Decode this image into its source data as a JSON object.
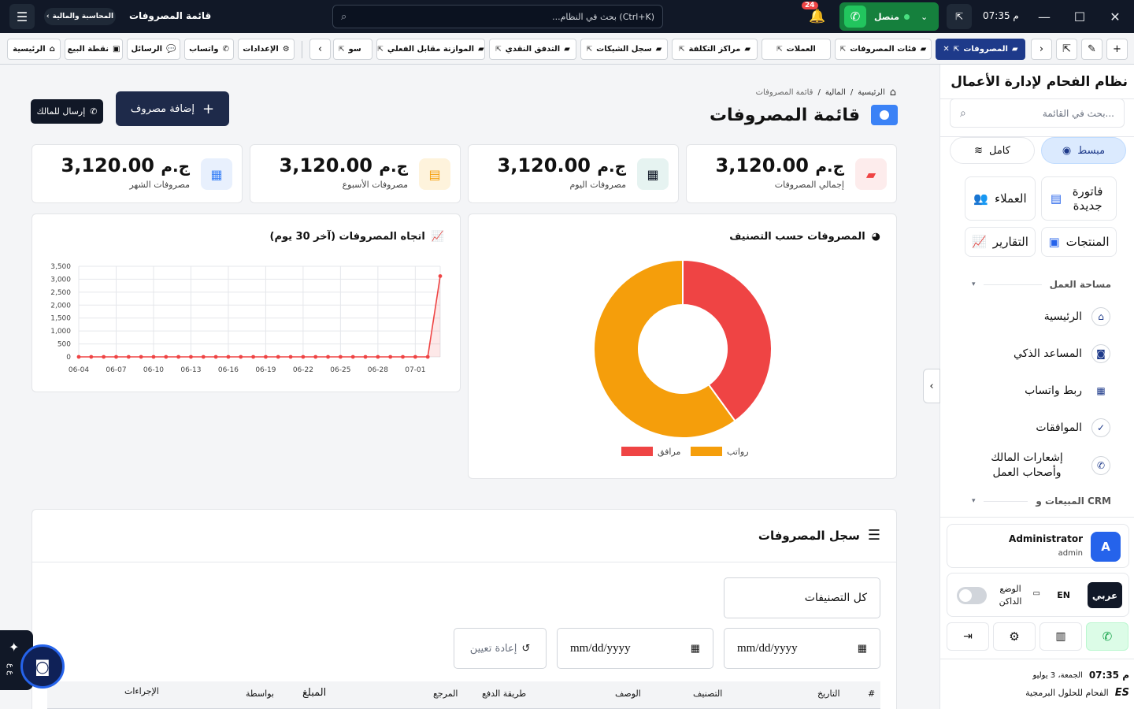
{
  "topbar": {
    "time": "07:35 م",
    "status": "متصل",
    "notifications_count": "24",
    "search_placeholder": "...بحث في النظام",
    "search_shortcut": "(Ctrl+K)",
    "page_title": "قائمة المصروفات",
    "section_pill": "المحاسبة والمالية"
  },
  "tabs": [
    {
      "label": "المصروفات",
      "active": true
    },
    {
      "label": "فئات المصروفات"
    },
    {
      "label": "العملات"
    },
    {
      "label": "مراكز التكلفة"
    },
    {
      "label": "سجل الشيكات"
    },
    {
      "label": "التدفق النقدي"
    },
    {
      "label": "الموازنة مقابل الفعلي"
    },
    {
      "label": "سو"
    }
  ],
  "shortcuts": {
    "settings": "الإعدادات",
    "whatsapp": "واتساب",
    "messages": "الرسائل",
    "pos": "نقطة البيع",
    "home": "الرئيسية"
  },
  "sidebar": {
    "brand": "نظام الفحام لإدارة الأعمال",
    "search_placeholder": "بحث في القائمة...",
    "mode_simple": "مبسط",
    "mode_full": "كامل",
    "quick": {
      "new_invoice": "فاتورة جديدة",
      "customers": "العملاء",
      "products": "المنتجات",
      "reports": "التقارير"
    },
    "section_workspace": "مساحة العمل",
    "links": {
      "home": "الرئيسية",
      "assistant": "المساعد الذكي",
      "whatsapp_link": "ربط واتساب",
      "approvals": "الموافقات",
      "owner_notify": "إشعارات المالك وأصحاب العمل"
    },
    "section_sales": "المبيعات و CRM",
    "user": {
      "name": "Administrator",
      "role": "admin",
      "initial": "A"
    },
    "lang_ar": "عربي",
    "lang_en": "EN",
    "dark_mode": "الوضع الداكن",
    "footer_time": "07:35 م",
    "footer_date": "الجمعة، 3 يوليو",
    "company": "الفحام للحلول البرمجية"
  },
  "page": {
    "breadcrumb": {
      "home": "الرئيسية",
      "finance": "المالية",
      "current": "قائمة المصروفات"
    },
    "title": "قائمة المصروفات",
    "add_button": "إضافة مصروف",
    "send_owner": "إرسال للمالك"
  },
  "stats": [
    {
      "value": "3,120.00",
      "currency": "ج.م",
      "label": "إجمالي المصروفات",
      "color": "#ef4444",
      "bg": "#fdecec"
    },
    {
      "value": "3,120.00",
      "currency": "ج.م",
      "label": "مصروفات اليوم",
      "color": "#111827",
      "bg": "#e6f3f1"
    },
    {
      "value": "3,120.00",
      "currency": "ج.م",
      "label": "مصروفات الأسبوع",
      "color": "#f59e0b",
      "bg": "#fef3dc"
    },
    {
      "value": "3,120.00",
      "currency": "ج.م",
      "label": "مصروفات الشهر",
      "color": "#3b82f6",
      "bg": "#e8f0fd"
    }
  ],
  "pie_card": {
    "title": "المصروفات حسب التصنيف"
  },
  "line_card": {
    "title": "اتجاه المصروفات (آخر 30 يوم)"
  },
  "chart_data": [
    {
      "type": "pie",
      "categories": [
        "مرافق",
        "رواتب"
      ],
      "values": [
        40,
        60
      ],
      "colors": [
        "#ef4444",
        "#f59e0b"
      ],
      "legend": "bottom"
    },
    {
      "type": "line",
      "x": [
        "06-04",
        "06-05",
        "06-06",
        "06-07",
        "06-08",
        "06-09",
        "06-10",
        "06-11",
        "06-12",
        "06-13",
        "06-14",
        "06-15",
        "06-16",
        "06-17",
        "06-18",
        "06-19",
        "06-20",
        "06-21",
        "06-22",
        "06-23",
        "06-24",
        "06-25",
        "06-26",
        "06-27",
        "06-28",
        "06-29",
        "06-30",
        "07-01",
        "07-02",
        "07-03"
      ],
      "series": [
        {
          "values": [
            0,
            0,
            0,
            0,
            0,
            0,
            0,
            0,
            0,
            0,
            0,
            0,
            0,
            0,
            0,
            0,
            0,
            0,
            0,
            0,
            0,
            0,
            0,
            0,
            0,
            0,
            0,
            0,
            0,
            3120
          ],
          "color": "#ef4444"
        }
      ],
      "xticks": [
        "06-04",
        "06-07",
        "06-10",
        "06-13",
        "06-16",
        "06-19",
        "06-22",
        "06-25",
        "06-28",
        "07-01"
      ],
      "ylim": [
        0,
        3500
      ],
      "yticks": [
        "0",
        "500",
        "1,000",
        "1,500",
        "2,000",
        "2,500",
        "3,000",
        "3,500"
      ],
      "grid": true
    }
  ],
  "log": {
    "title": "سجل المصروفات",
    "category_filter": "كل التصنيفات",
    "date_placeholder": "mm/dd/yyyy",
    "reset": "إعادة تعيين",
    "columns": [
      "#",
      "التاريخ",
      "التصنيف",
      "الوصف",
      "طريقة الدفع",
      "المرجع",
      "المبلغ",
      "بواسطة",
      "الإجراءات"
    ]
  },
  "ai_fab": "ع ع"
}
